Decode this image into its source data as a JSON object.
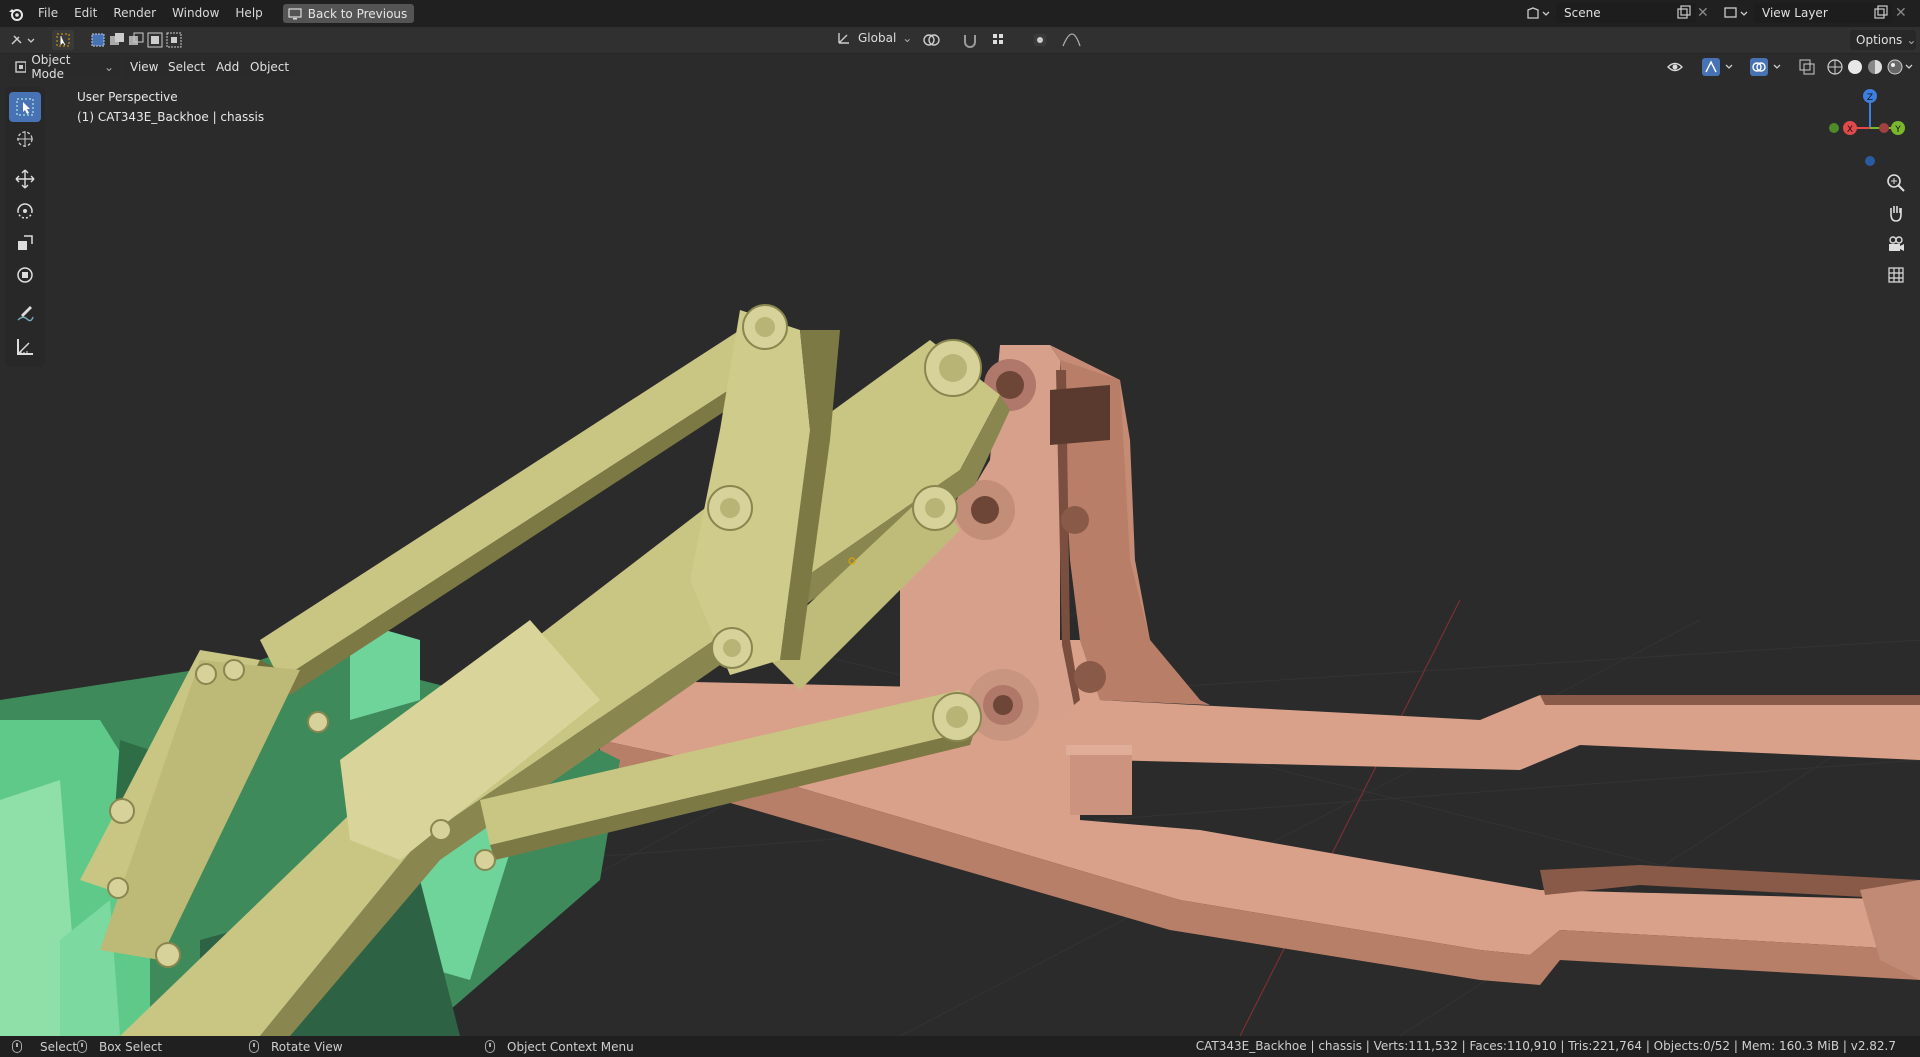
{
  "topbar": {
    "menus": [
      "File",
      "Edit",
      "Render",
      "Window",
      "Help"
    ],
    "back_button": "Back to Previous",
    "scene": "Scene",
    "view_layer": "View Layer"
  },
  "header": {
    "mode": "Object Mode",
    "menus": [
      "View",
      "Select",
      "Add",
      "Object"
    ],
    "transform_orientation": "Global",
    "options": "Options"
  },
  "viewport": {
    "perspective_label": "User Perspective",
    "object_label": "(1) CAT343E_Backhoe | chassis"
  },
  "gizmo": {
    "x": "X",
    "y": "Y",
    "z": "Z"
  },
  "tools": [
    "select-box",
    "cursor",
    "move",
    "rotate",
    "scale",
    "transform",
    "annotate",
    "measure"
  ],
  "statusbar": {
    "select": "Select",
    "box_select": "Box Select",
    "rotate_view": "Rotate View",
    "context_menu": "Object Context Menu",
    "stats": "CAT343E_Backhoe | chassis | Verts:111,532 | Faces:110,910 | Tris:221,764 | Objects:0/52 | Mem: 160.3 MiB | v2.82.7"
  },
  "colors": {
    "boom": "#c9c583",
    "chassis": "#d9a189",
    "bucket": "#5fc98a",
    "accent": "#4772b3"
  }
}
